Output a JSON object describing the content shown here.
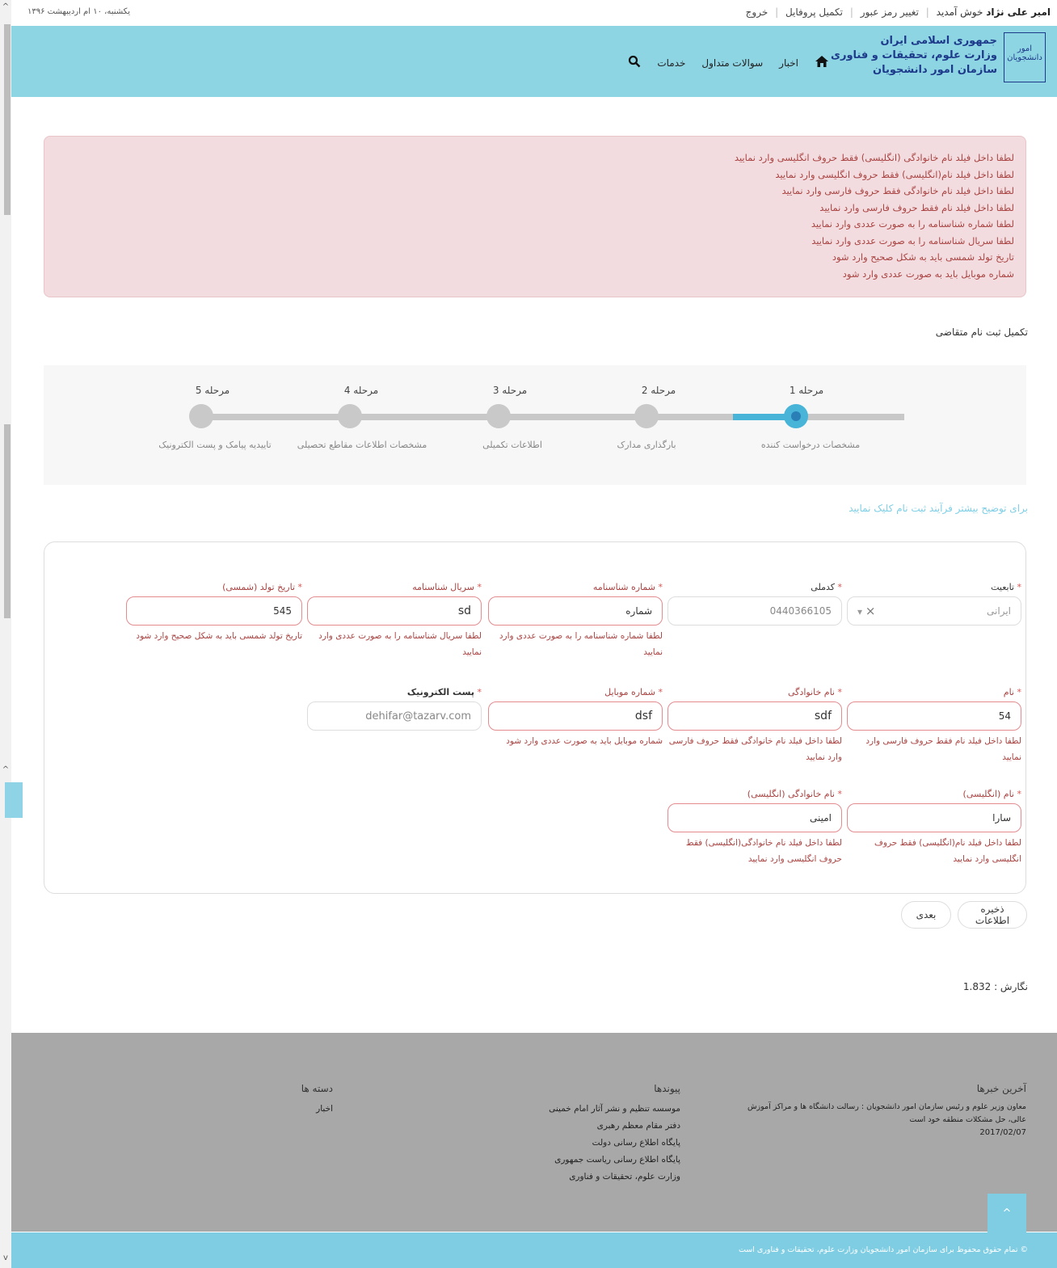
{
  "topbar": {
    "date": "یکشنبه، ۱۰ ام اردیبهشت ۱۳۹۶",
    "user_name": "امیر علی نژاد",
    "welcome": "خوش آمدید",
    "change_password": "تغییر رمز عبور",
    "complete_profile": "تکمیل پروفایل",
    "logout": "خروج"
  },
  "header": {
    "logo_text": "امور دانشجویان",
    "brand_line1": "جمهوری اسلامی ایران",
    "brand_line2": "وزارت علوم، تحقیقات و فناوری",
    "brand_line3": "سازمان امور دانشجویان",
    "nav": {
      "news": "اخبار",
      "faq": "سوالات متداول",
      "services": "خدمات"
    },
    "icons": {
      "home": "home-icon",
      "search": "search-icon"
    }
  },
  "alert": {
    "messages": [
      "لطفا داخل فیلد نام خانوادگی (انگلیسی) فقط حروف انگلیسی وارد نمایید",
      "لطفا داخل فیلد نام(انگلیسی) فقط حروف انگلیسی وارد نمایید",
      "لطفا داخل فیلد نام خانوادگی فقط حروف فارسی وارد نمایید",
      "لطفا داخل فیلد نام فقط حروف فارسی وارد نمایید",
      "لطفا شماره شناسنامه را به صورت عددی وارد نمایید",
      "لطفا سریال شناسنامه را به صورت عددی وارد نمایید",
      "تاریخ تولد شمسی باید به شکل صحیح وارد شود",
      "شماره موبایل باید به صورت عددی وارد شود"
    ]
  },
  "page_title": "تکمیل ثبت نام متقاضی",
  "steps": [
    {
      "title": "مرحله 1",
      "label": "مشخصات درخواست کننده",
      "active": true
    },
    {
      "title": "مرحله 2",
      "label": "بارگذاری مدارک",
      "active": false
    },
    {
      "title": "مرحله 3",
      "label": "اطلاعات تکمیلی",
      "active": false
    },
    {
      "title": "مرحله 4",
      "label": "مشخصات اطلاعات مقاطع تحصیلی",
      "active": false
    },
    {
      "title": "مرحله 5",
      "label": "تاییدیه پیامک و پست الکترونیک",
      "active": false
    }
  ],
  "help_link": "برای توضیح بیشتر فرآیند ثبت نام کلیک نمایید",
  "required_mark": "*",
  "form": {
    "nationality": {
      "label": "تابعیت",
      "value": "ایرانی",
      "clear": "×",
      "arrow": "▾"
    },
    "national_code": {
      "label": "کدملی",
      "value": "0440366105"
    },
    "id_number": {
      "label": "شماره شناسنامه",
      "value": "شماره",
      "error": "لطفا شماره شناسنامه را به صورت عددی وارد نمایید"
    },
    "id_serial": {
      "label": "سریال شناسنامه",
      "value": "sd",
      "error": "لطفا سریال شناسنامه را به صورت عددی وارد نمایید"
    },
    "birth_date": {
      "label": "تاریخ تولد (شمسی)",
      "value": "545",
      "error": "تاریخ تولد شمسی باید به شکل صحیح وارد شود"
    },
    "first_name": {
      "label": "نام",
      "value": "54",
      "error": "لطفا داخل فیلد نام فقط حروف فارسی وارد نمایید"
    },
    "last_name": {
      "label": "نام خانوادگی",
      "value": "sdf",
      "error": "لطفا داخل فیلد نام خانوادگی فقط حروف فارسی وارد نمایید"
    },
    "mobile": {
      "label": "شماره موبایل",
      "value": "dsf",
      "error": "شماره موبایل باید به صورت عددی وارد شود"
    },
    "email": {
      "label": "پست الکترونیک",
      "value": "dehifar@tazarv.com"
    },
    "first_name_en": {
      "label": "نام (انگلیسی)",
      "value": "سارا",
      "error": "لطفا داخل فیلد نام(انگلیسی) فقط حروف انگلیسی وارد نمایید"
    },
    "last_name_en": {
      "label": "نام خانوادگی (انگلیسی)",
      "value": "امینی",
      "error": "لطفا داخل فیلد نام خانوادگی(انگلیسی) فقط حروف انگلیسی وارد نمایید"
    }
  },
  "buttons": {
    "save": "ذخیره اطلاعات",
    "next": "بعدی"
  },
  "version": "نگارش : 1.832",
  "footer": {
    "news": {
      "title": "آخرین خبرها",
      "text": "معاون وزیر علوم و رئیس سازمان امور دانشجویان : رسالت دانشگاه ها و مراکز آموزش عالی، حل مشکلات منطقه خود است",
      "date": "2017/02/07"
    },
    "links": {
      "title": "پیوندها",
      "items": [
        "موسسه تنظیم و نشر آثار امام خمینی",
        "دفتر مقام معظم رهبری",
        "پایگاه اطلاع رسانی دولت",
        "پایگاه اطلاع رسانی ریاست جمهوری",
        "وزارت علوم، تحقیقات و فناوری"
      ]
    },
    "categories": {
      "title": "دسته ها",
      "items": [
        "اخبار"
      ]
    },
    "to_top": "^",
    "copyright": "© تمام حقوق محفوظ برای سازمان امور دانشجویان وزارت علوم، تحقیقات و فناوری است"
  },
  "scrollbar": {
    "up": "^",
    "down": "v",
    "mid": "^"
  }
}
